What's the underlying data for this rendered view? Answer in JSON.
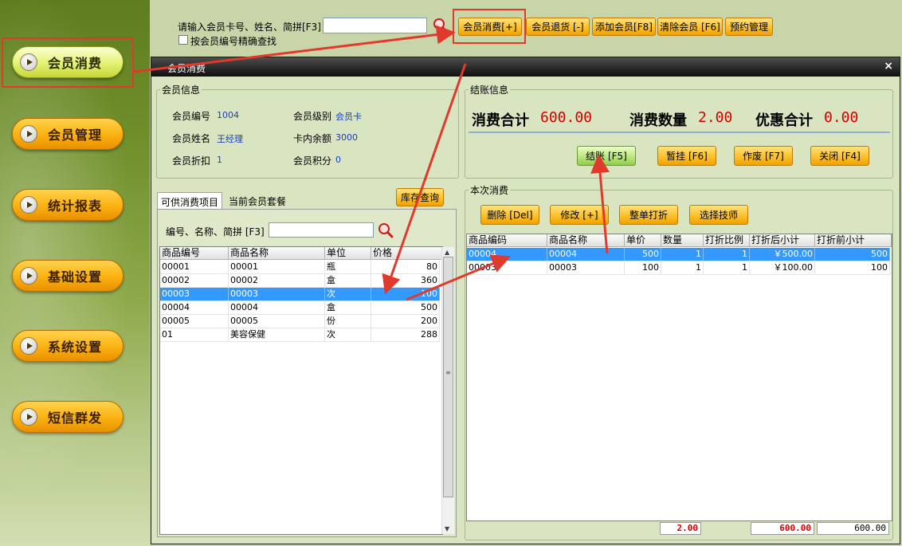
{
  "sidebar": {
    "items": [
      {
        "label": "会员消费"
      },
      {
        "label": "会员管理"
      },
      {
        "label": "统计报表"
      },
      {
        "label": "基础设置"
      },
      {
        "label": "系统设置"
      },
      {
        "label": "短信群发"
      }
    ]
  },
  "topbar": {
    "search_label": "请输入会员卡号、姓名、简拼[F3]",
    "search_value": "",
    "exact_label": "按会员编号精确查找",
    "buttons": [
      "会员消费[+]",
      "会员退货 [-]",
      "添加会员[F8]",
      "清除会员 [F6]",
      "预约管理"
    ]
  },
  "dialog": {
    "title": "会员消费",
    "close": "×",
    "member_info": {
      "title": "会员信息",
      "fields": [
        {
          "label": "会员编号",
          "value": "1004"
        },
        {
          "label": "会员级别",
          "value": "会员卡"
        },
        {
          "label": "会员姓名",
          "value": "王经理"
        },
        {
          "label": "卡内余额",
          "value": "3000"
        },
        {
          "label": "会员折扣",
          "value": "1"
        },
        {
          "label": "会员积分",
          "value": "0"
        }
      ]
    },
    "checkout": {
      "title": "结账信息",
      "total_label": "消费合计",
      "total_value": "600.00",
      "qty_label": "消费数量",
      "qty_value": "2.00",
      "discount_label": "优惠合计",
      "discount_value": "0.00",
      "buttons": [
        "结账 [F5]",
        "暂挂 [F6]",
        "作废 [F7]",
        "关闭 [F4]"
      ]
    },
    "tabs": [
      "可供消费项目",
      "当前会员套餐"
    ],
    "stock_button": "库存查询",
    "product_search_label": "编号、名称、简拼 [F3]",
    "product_search_value": "",
    "products": {
      "headers": [
        "商品编号",
        "商品名称",
        "单位",
        "价格"
      ],
      "rows": [
        [
          "00001",
          "00001",
          "瓶",
          "80"
        ],
        [
          "00002",
          "00002",
          "盒",
          "360"
        ],
        [
          "00003",
          "00003",
          "次",
          "100"
        ],
        [
          "00004",
          "00004",
          "盒",
          "500"
        ],
        [
          "00005",
          "00005",
          "份",
          "200"
        ],
        [
          "01",
          "美容保健",
          "次",
          "288"
        ]
      ]
    },
    "current": {
      "title": "本次消费",
      "buttons": [
        "删除 [Del]",
        "修改 [+]",
        "整单打折",
        "选择技师"
      ],
      "headers": [
        "商品编码",
        "商品名称",
        "单价",
        "数量",
        "打折比例",
        "打折后小计",
        "打折前小计"
      ],
      "rows": [
        [
          "00004",
          "00004",
          "500",
          "1",
          "1",
          "￥500.00",
          "500"
        ],
        [
          "00003",
          "00003",
          "100",
          "1",
          "1",
          "￥100.00",
          "100"
        ]
      ],
      "footer": {
        "qty": "2.00",
        "after": "600.00",
        "before": "600.00"
      }
    }
  },
  "colors": {
    "annotation": "#e03a2c",
    "selection": "#3399ff",
    "accent_orange": "#fbbd26",
    "total_red": "#d40000"
  }
}
